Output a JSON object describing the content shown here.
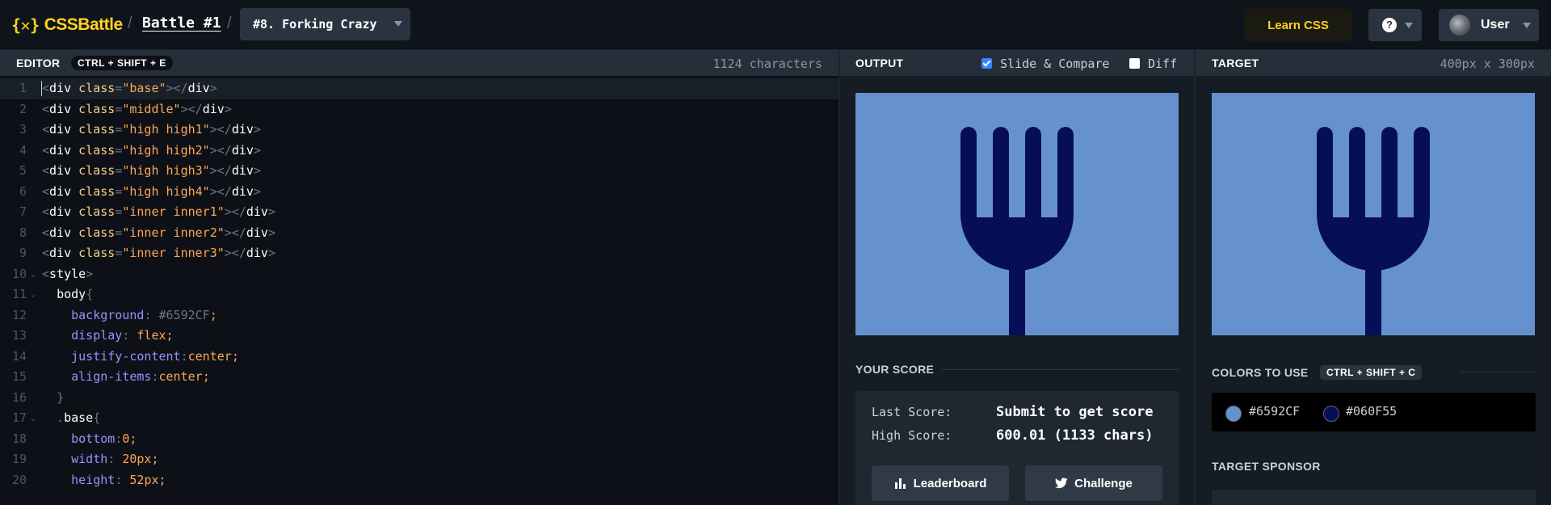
{
  "header": {
    "logo_text": "CSSBattle",
    "logo_mark": "{✕}",
    "separator": "/",
    "battle_link": "Battle #1",
    "level_select": "#8. Forking Crazy",
    "learn_button": "Learn CSS",
    "help_icon_text": "?",
    "user_label": "User"
  },
  "editor": {
    "title": "EDITOR",
    "shortcut": "CTRL + SHIFT + E",
    "char_count": "1124 characters",
    "lines": [
      [
        [
          "<",
          "p"
        ],
        [
          "div",
          "tag"
        ],
        [
          " ",
          "p"
        ],
        [
          "class",
          "attr"
        ],
        [
          "=",
          "p"
        ],
        [
          "\"base\"",
          "str"
        ],
        [
          "></",
          "p"
        ],
        [
          "div",
          "tag"
        ],
        [
          ">",
          "p"
        ]
      ],
      [
        [
          "<",
          "p"
        ],
        [
          "div",
          "tag"
        ],
        [
          " ",
          "p"
        ],
        [
          "class",
          "attr"
        ],
        [
          "=",
          "p"
        ],
        [
          "\"middle\"",
          "str"
        ],
        [
          "></",
          "p"
        ],
        [
          "div",
          "tag"
        ],
        [
          ">",
          "p"
        ]
      ],
      [
        [
          "<",
          "p"
        ],
        [
          "div",
          "tag"
        ],
        [
          " ",
          "p"
        ],
        [
          "class",
          "attr"
        ],
        [
          "=",
          "p"
        ],
        [
          "\"high high1\"",
          "str"
        ],
        [
          "></",
          "p"
        ],
        [
          "div",
          "tag"
        ],
        [
          ">",
          "p"
        ]
      ],
      [
        [
          "<",
          "p"
        ],
        [
          "div",
          "tag"
        ],
        [
          " ",
          "p"
        ],
        [
          "class",
          "attr"
        ],
        [
          "=",
          "p"
        ],
        [
          "\"high high2\"",
          "str"
        ],
        [
          "></",
          "p"
        ],
        [
          "div",
          "tag"
        ],
        [
          ">",
          "p"
        ]
      ],
      [
        [
          "<",
          "p"
        ],
        [
          "div",
          "tag"
        ],
        [
          " ",
          "p"
        ],
        [
          "class",
          "attr"
        ],
        [
          "=",
          "p"
        ],
        [
          "\"high high3\"",
          "str"
        ],
        [
          "></",
          "p"
        ],
        [
          "div",
          "tag"
        ],
        [
          ">",
          "p"
        ]
      ],
      [
        [
          "<",
          "p"
        ],
        [
          "div",
          "tag"
        ],
        [
          " ",
          "p"
        ],
        [
          "class",
          "attr"
        ],
        [
          "=",
          "p"
        ],
        [
          "\"high high4\"",
          "str"
        ],
        [
          "></",
          "p"
        ],
        [
          "div",
          "tag"
        ],
        [
          ">",
          "p"
        ]
      ],
      [
        [
          "<",
          "p"
        ],
        [
          "div",
          "tag"
        ],
        [
          " ",
          "p"
        ],
        [
          "class",
          "attr"
        ],
        [
          "=",
          "p"
        ],
        [
          "\"inner inner1\"",
          "str"
        ],
        [
          "></",
          "p"
        ],
        [
          "div",
          "tag"
        ],
        [
          ">",
          "p"
        ]
      ],
      [
        [
          "<",
          "p"
        ],
        [
          "div",
          "tag"
        ],
        [
          " ",
          "p"
        ],
        [
          "class",
          "attr"
        ],
        [
          "=",
          "p"
        ],
        [
          "\"inner inner2\"",
          "str"
        ],
        [
          "></",
          "p"
        ],
        [
          "div",
          "tag"
        ],
        [
          ">",
          "p"
        ]
      ],
      [
        [
          "<",
          "p"
        ],
        [
          "div",
          "tag"
        ],
        [
          " ",
          "p"
        ],
        [
          "class",
          "attr"
        ],
        [
          "=",
          "p"
        ],
        [
          "\"inner inner3\"",
          "str"
        ],
        [
          "></",
          "p"
        ],
        [
          "div",
          "tag"
        ],
        [
          ">",
          "p"
        ]
      ],
      [
        [
          "<",
          "p"
        ],
        [
          "style",
          "tag"
        ],
        [
          ">",
          "p"
        ]
      ],
      [
        [
          "  ",
          "p"
        ],
        [
          "body",
          "sel"
        ],
        [
          "{",
          "p"
        ]
      ],
      [
        [
          "    ",
          "p"
        ],
        [
          "background",
          "prop"
        ],
        [
          ": ",
          "p"
        ],
        [
          "#6592CF",
          "p"
        ],
        [
          ";",
          "val"
        ]
      ],
      [
        [
          "    ",
          "p"
        ],
        [
          "display",
          "prop"
        ],
        [
          ": ",
          "p"
        ],
        [
          "flex",
          "val"
        ],
        [
          ";",
          "val"
        ]
      ],
      [
        [
          "    ",
          "p"
        ],
        [
          "justify-content",
          "prop"
        ],
        [
          ":",
          "p"
        ],
        [
          "center",
          "val"
        ],
        [
          ";",
          "val"
        ]
      ],
      [
        [
          "    ",
          "p"
        ],
        [
          "align-items",
          "prop"
        ],
        [
          ":",
          "p"
        ],
        [
          "center",
          "val"
        ],
        [
          ";",
          "val"
        ]
      ],
      [
        [
          "  ",
          "p"
        ],
        [
          "}",
          "p"
        ]
      ],
      [
        [
          "  .",
          "p"
        ],
        [
          "base",
          "sel"
        ],
        [
          "{",
          "p"
        ]
      ],
      [
        [
          "    ",
          "p"
        ],
        [
          "bottom",
          "prop"
        ],
        [
          ":",
          "p"
        ],
        [
          "0",
          "val"
        ],
        [
          ";",
          "val"
        ]
      ],
      [
        [
          "    ",
          "p"
        ],
        [
          "width",
          "prop"
        ],
        [
          ": ",
          "p"
        ],
        [
          "20",
          "val"
        ],
        [
          "px;",
          "val"
        ]
      ],
      [
        [
          "    ",
          "p"
        ],
        [
          "height",
          "prop"
        ],
        [
          ": ",
          "p"
        ],
        [
          "52",
          "val"
        ],
        [
          "px;",
          "val"
        ]
      ]
    ],
    "fold_lines": [
      10,
      11,
      17
    ],
    "fold_glyph": "⌄"
  },
  "output": {
    "title": "OUTPUT",
    "slide_compare_label": "Slide & Compare",
    "slide_compare_checked": true,
    "diff_label": "Diff",
    "diff_checked": false,
    "score_title": "YOUR SCORE",
    "last_score_label": "Last Score:",
    "last_score_value": "Submit to get score",
    "high_score_label": "High Score:",
    "high_score_value": "600.01 (1133 chars)",
    "leaderboard_button": "Leaderboard",
    "challenge_button": "Challenge"
  },
  "target": {
    "title": "TARGET",
    "size": "400px x 300px",
    "colors_title": "COLORS TO USE",
    "colors_shortcut": "CTRL + SHIFT + C",
    "colors": [
      "#6592CF",
      "#060F55"
    ],
    "sponsor_title": "TARGET SPONSOR"
  },
  "canvas_colors": {
    "background": "#6592CF",
    "fork": "#060F55"
  }
}
